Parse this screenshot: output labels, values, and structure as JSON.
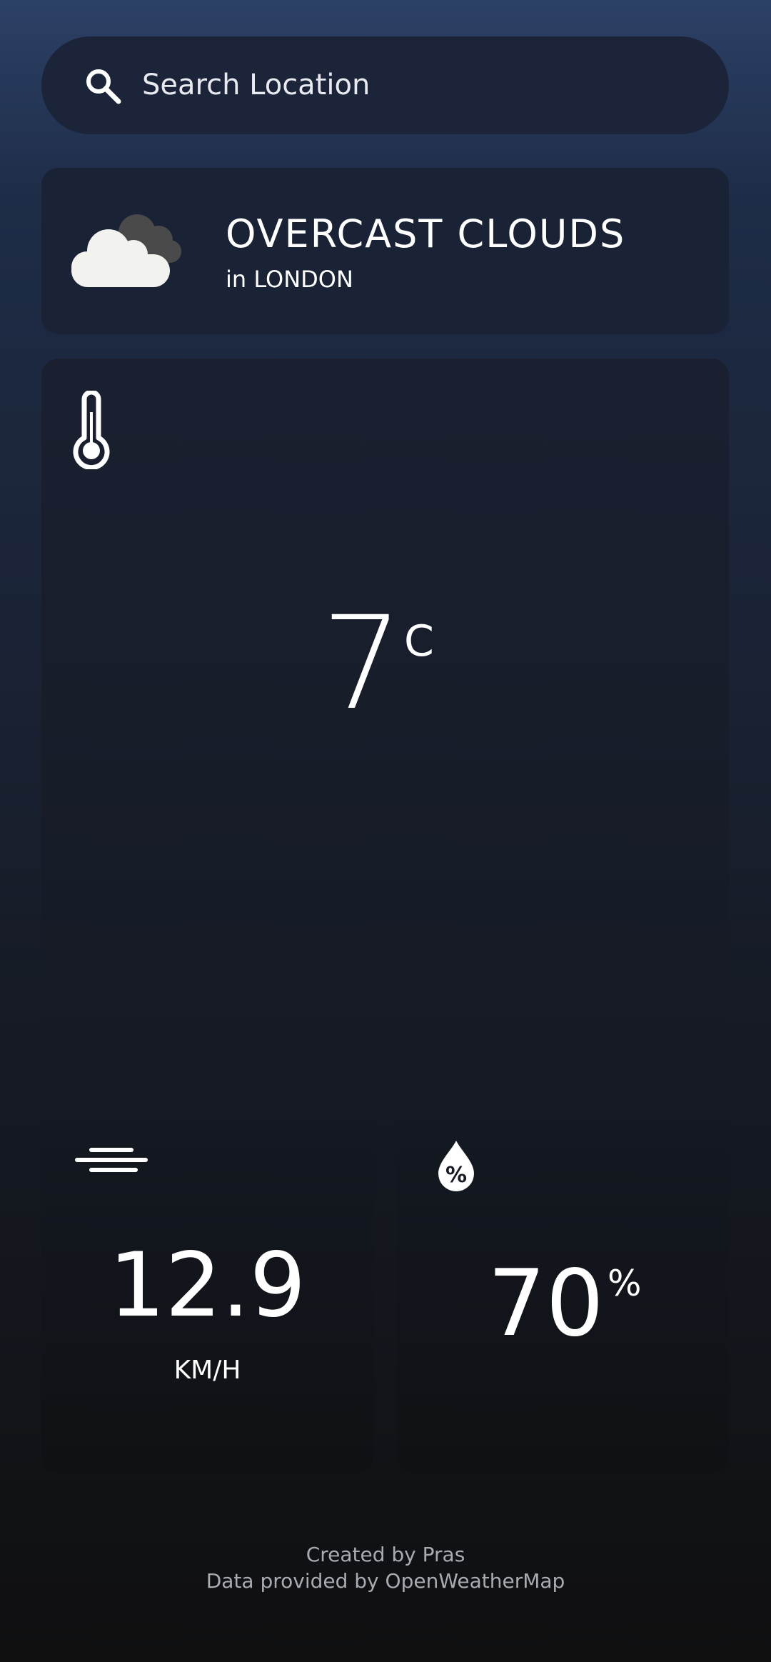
{
  "search": {
    "placeholder": "Search Location",
    "icon": "search-icon"
  },
  "summary": {
    "condition": "OVERCAST CLOUDS",
    "location": "in LONDON",
    "icon": "overcast-clouds-icon"
  },
  "temperature": {
    "value": "7",
    "unit": "C",
    "icon": "thermometer-icon"
  },
  "wind": {
    "value": "12.9",
    "unit": "KM/H",
    "icon": "wind-icon"
  },
  "humidity": {
    "value": "70",
    "unit": "%",
    "icon": "humidity-icon"
  },
  "footer": {
    "created_by": "Created by Pras",
    "data_source": "Data provided by OpenWeatherMap"
  },
  "colors": {
    "background_top": "#2c4166",
    "background_bottom": "#0f0f10",
    "card": "#1a2336",
    "text": "#ffffff",
    "footer_text": "#a9abb2"
  }
}
